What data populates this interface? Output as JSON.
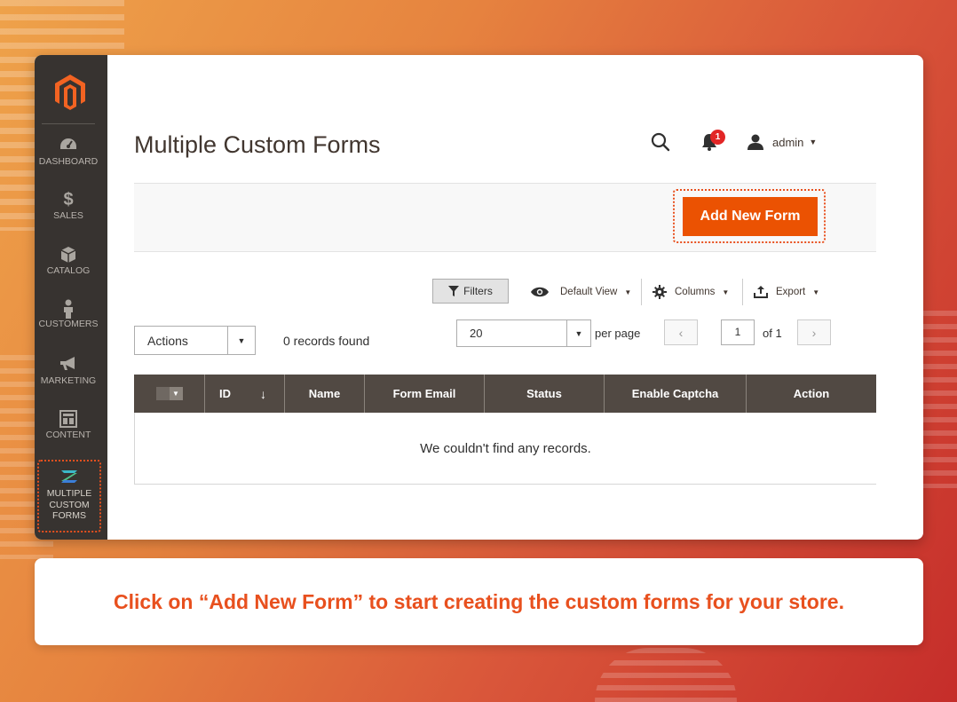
{
  "colors": {
    "accent": "#eb5202",
    "sidebar": "#373330",
    "grid_header": "#514943",
    "caption": "#e8501e"
  },
  "sidebar": {
    "logo": "magento-logo",
    "items": [
      {
        "label": "DASHBOARD",
        "icon": "gauge-icon"
      },
      {
        "label": "SALES",
        "icon": "dollar-icon"
      },
      {
        "label": "CATALOG",
        "icon": "box-icon"
      },
      {
        "label": "CUSTOMERS",
        "icon": "person-icon"
      },
      {
        "label": "MARKETING",
        "icon": "megaphone-icon"
      },
      {
        "label": "CONTENT",
        "icon": "layout-icon"
      }
    ],
    "active": {
      "label_lines": [
        "MULTIPLE",
        "CUSTOM",
        "FORMS"
      ],
      "icon": "z-logo-icon"
    }
  },
  "header": {
    "title": "Multiple Custom Forms",
    "notifications_count": "1",
    "user": "admin"
  },
  "toolbar": {
    "add_button": "Add New Form"
  },
  "grid_controls": {
    "filters": "Filters",
    "view": "Default View",
    "columns": "Columns",
    "export": "Export",
    "actions": "Actions",
    "records": "0 records found",
    "per_page_value": "20",
    "per_page_label": "per page",
    "page_value": "1",
    "page_of": "of 1"
  },
  "grid": {
    "columns": [
      "ID",
      "Name",
      "Form Email",
      "Status",
      "Enable Captcha",
      "Action"
    ],
    "empty_message": "We couldn't find any records."
  },
  "caption": "Click on “Add New Form” to start creating the custom forms for your store."
}
